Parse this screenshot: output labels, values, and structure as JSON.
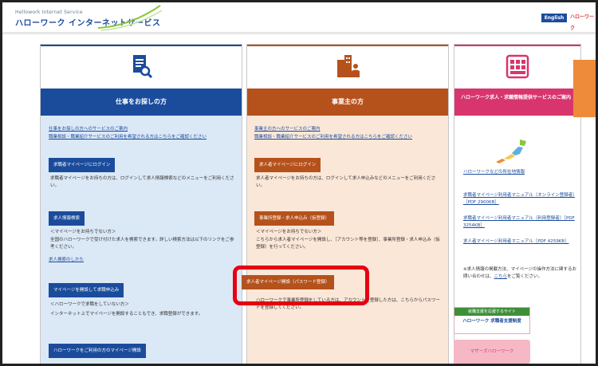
{
  "header": {
    "logo_sub": "Hellowork Internet Service",
    "logo_main": "ハローワーク インターネットサービス",
    "en_button": "English",
    "hw_button": "ハローワーク"
  },
  "columns": {
    "job_seeker": {
      "title": "仕事をお探しの方",
      "links": [
        "仕事をお探しの方へのサービスのご案内",
        "職業相談・職業紹介サービスのご利用を希望される方はこちらをご確認ください"
      ],
      "btn_login": "求職者マイページにログイン",
      "text_login": "求職者マイページをお持ちの方は、ログインして求人情報検索などのメニューをご利用ください。",
      "btn_search": "求人情報検索",
      "text_no_mypage": "＜マイページをお持ちでない方＞",
      "text_search": "全国のハローワークで受け付けた求人を検索できます。詳しい検索方法は以下のリンクをご参考ください。",
      "link_how": "求人検索のしかた",
      "btn_register": "マイページを開設して求職申込み",
      "text_no_hw": "＜ハローワークで求職をしていない方＞",
      "text_register": "インターネット上でマイページを開設することもでき、求職登録ができます。",
      "btn_hw_user": "ハローワークをご利用の方のマイページ開設"
    },
    "employer": {
      "title": "事業主の方",
      "links": [
        "事業主の方へのサービスのご案内",
        "職業相談・職業紹介サービスのご利用を希望される方はこちらをご確認ください"
      ],
      "btn_login": "求人者マイページにログイン",
      "text_login": "求人者マイページをお持ちの方は、ログインして求人申込みなどのメニューをご利用ください。",
      "btn_register": "事業所登録・求人申込み（仮登録）",
      "text_no_mypage": "＜マイページをお持ちでない方＞",
      "text_register": "こちらから求人者マイページを開設し、［アカウント等を登録］、事業所登録・求人申込み（仮登録）を行ってください。",
      "btn_open": "求人者マイページ開設（パスワード登録）",
      "text_open": "ハローワークで事業所登録をしている方は、アカウントを登録した方は、こちらからパスワードを登録してください。"
    },
    "services": {
      "title": "ハローワーク求人・求職情報提供サービスのご案内",
      "map_link": "ハローワークなどの所在地情報",
      "manuals": [
        "求職者マイページ利用者マニュアル（オンライン登録者）［PDF 2900KB］",
        "求職者マイページ利用者マニュアル（利用登録者）［PDF 3254KB］",
        "求人者マイページ利用者マニュアル［PDF 4259KB］"
      ],
      "text_privacy": "※求人情報の掲載方法、マイページの操作方法に関するお問い合わせは、",
      "link_here": "こちら",
      "text_privacy_end": "をご覧ください。",
      "banner_top": "就職支援を応援するサイト",
      "banner_main": "ハローワーク 求職者支援制度",
      "pink_banner": "マザーズハローワーク"
    }
  }
}
